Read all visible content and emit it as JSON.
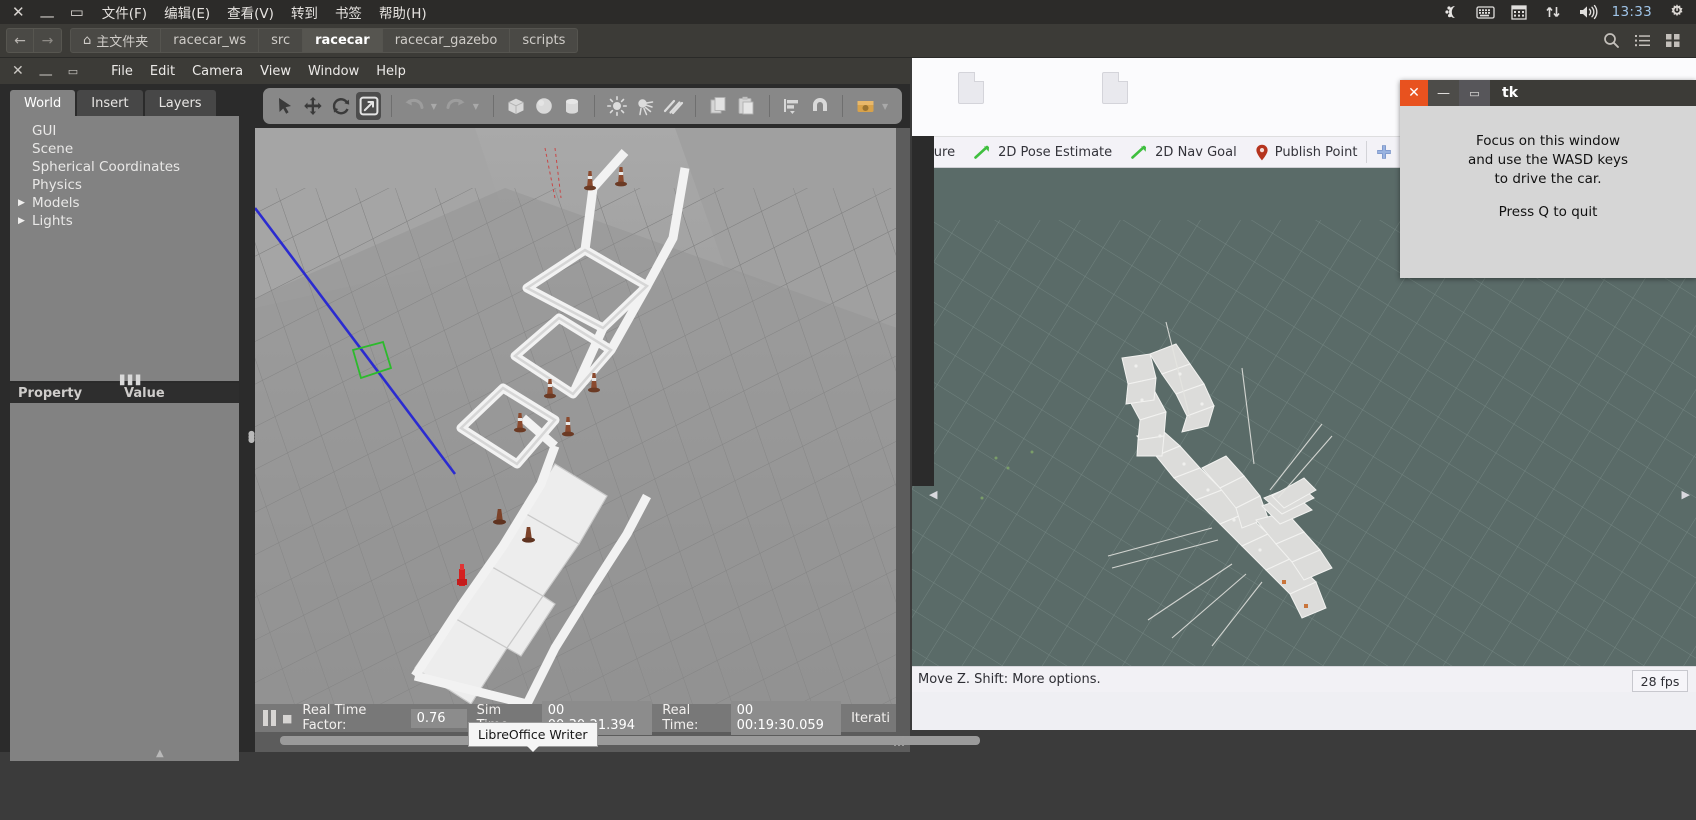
{
  "top_panel": {
    "window_controls": {
      "close": "✕",
      "minimize": "—",
      "maximize": "▭"
    },
    "menu": [
      "文件(F)",
      "编辑(E)",
      "查看(V)",
      "转到",
      "书签",
      "帮助(H)"
    ],
    "tray": {
      "icons": [
        "ubuntu-one-icon",
        "keyboard-icon",
        "calendar-icon",
        "network-updown-icon",
        "volume-icon"
      ],
      "clock": "13:33",
      "power_icon": "power-gear-icon"
    }
  },
  "pathbar": {
    "back_icon": "←",
    "forward_icon": "→",
    "home_icon": "⌂",
    "crumbs": [
      {
        "label": "主文件夹",
        "active": false,
        "home": true
      },
      {
        "label": "racecar_ws",
        "active": false
      },
      {
        "label": "src",
        "active": false
      },
      {
        "label": "racecar",
        "active": true
      },
      {
        "label": "racecar_gazebo",
        "active": false
      },
      {
        "label": "scripts",
        "active": false
      }
    ],
    "right_icons": [
      "search-icon",
      "list-view-icon",
      "grid-view-icon"
    ]
  },
  "gazebo": {
    "window_controls": {
      "close": "✕",
      "minimize": "—",
      "maximize": "▭"
    },
    "menu": [
      "File",
      "Edit",
      "Camera",
      "View",
      "Window",
      "Help"
    ],
    "tabs": [
      {
        "label": "World",
        "active": true
      },
      {
        "label": "Insert",
        "active": false
      },
      {
        "label": "Layers",
        "active": false
      }
    ],
    "tree": [
      {
        "label": "GUI",
        "expandable": false
      },
      {
        "label": "Scene",
        "expandable": false
      },
      {
        "label": "Spherical Coordinates",
        "expandable": false
      },
      {
        "label": "Physics",
        "expandable": false
      },
      {
        "label": "Models",
        "expandable": true
      },
      {
        "label": "Lights",
        "expandable": true
      }
    ],
    "property_table": {
      "col_property": "Property",
      "col_value": "Value"
    },
    "toolbar": [
      {
        "name": "select-mode-icon",
        "selected": false
      },
      {
        "name": "translate-mode-icon",
        "selected": false
      },
      {
        "name": "rotate-mode-icon",
        "selected": false
      },
      {
        "name": "scale-mode-icon",
        "selected": true
      },
      {
        "name": "undo-icon",
        "selected": false
      },
      {
        "name": "undo-dropdown-icon",
        "selected": false
      },
      {
        "name": "redo-icon",
        "selected": false
      },
      {
        "name": "redo-dropdown-icon",
        "selected": false
      },
      {
        "name": "box-icon",
        "selected": false
      },
      {
        "name": "sphere-icon",
        "selected": false
      },
      {
        "name": "cylinder-icon",
        "selected": false
      },
      {
        "name": "point-light-icon",
        "selected": false
      },
      {
        "name": "spot-light-icon",
        "selected": false
      },
      {
        "name": "directional-light-icon",
        "selected": false
      },
      {
        "name": "copy-icon",
        "selected": false
      },
      {
        "name": "paste-icon",
        "selected": false
      },
      {
        "name": "align-icon",
        "selected": false
      },
      {
        "name": "snap-magnet-icon",
        "selected": false
      },
      {
        "name": "screenshot-icon",
        "selected": false
      },
      {
        "name": "log-dropdown-icon",
        "selected": false
      }
    ],
    "status": {
      "pause_icon": "pause-icon",
      "step_icon": "step-icon",
      "real_time_factor_label": "Real Time Factor:",
      "real_time_factor_value": "0.76",
      "sim_time_label": "Sim Time:",
      "sim_time_value": "00 00:30:21.394",
      "real_time_label": "Real Time:",
      "real_time_value": "00 00:19:30.059",
      "iterations_label": "Iterati"
    }
  },
  "rviz": {
    "toolbar": [
      {
        "label": "sure",
        "icon": "measure-icon",
        "partial": true
      },
      {
        "label": "2D Pose Estimate",
        "icon": "pose-arrow-icon"
      },
      {
        "label": "2D Nav Goal",
        "icon": "nav-arrow-icon"
      },
      {
        "label": "Publish Point",
        "icon": "map-pin-icon"
      }
    ],
    "right_tools": [
      {
        "name": "add-tool-icon"
      },
      {
        "name": "remove-tool-icon"
      },
      {
        "name": "remove-dropdown-icon"
      },
      {
        "name": "visibility-eye-icon"
      },
      {
        "name": "visibility-dropdown-icon"
      }
    ],
    "status_text": "Move Z. Shift: More options.",
    "fps": "28 fps",
    "scroll_left_icon": "◀",
    "scroll_right_icon": "▶"
  },
  "tk_dialog": {
    "title": "tk",
    "close_icon": "✕",
    "minimize_icon": "—",
    "maximize_icon": "▭",
    "line1": "Focus on this window",
    "line2": "and use the WASD keys",
    "line3": "to drive the car.",
    "line4": "Press Q to quit"
  },
  "tooltip": {
    "text": "LibreOffice Writer"
  },
  "colors": {
    "panel_bg": "#2c2b29",
    "pathbar_bg": "#3c3b37",
    "gazebo_panel": "#828282",
    "gazebo_viewport": "#9a9a9a",
    "rviz_canvas": "#5a6b68",
    "accent_orange": "#e8521f",
    "nav_green": "#3fbf3f",
    "pin_red": "#b5341e",
    "clock_blue": "#9fc4e8"
  }
}
